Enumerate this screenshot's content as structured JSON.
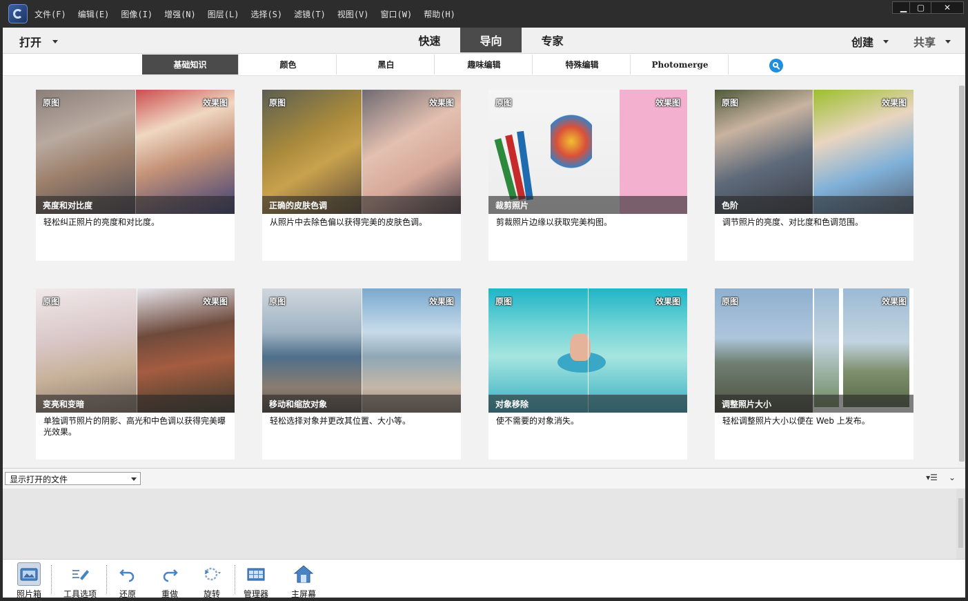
{
  "menu": [
    "文件(F)",
    "编辑(E)",
    "图像(I)",
    "增强(N)",
    "图层(L)",
    "选择(S)",
    "滤镜(T)",
    "视图(V)",
    "窗口(W)",
    "帮助(H)"
  ],
  "window_controls": {
    "minimize": "▁",
    "maximize": "▢",
    "close": "✕"
  },
  "modebar": {
    "open_label": "打开",
    "tabs": [
      {
        "label": "快速"
      },
      {
        "label": "导向",
        "active": true
      },
      {
        "label": "专家"
      }
    ],
    "create_label": "创建",
    "share_label": "共享"
  },
  "subtabs": [
    {
      "label": "基础知识",
      "active": true
    },
    {
      "label": "颜色"
    },
    {
      "label": "黑白"
    },
    {
      "label": "趣味编辑"
    },
    {
      "label": "特殊编辑"
    },
    {
      "label": "Photomerge"
    }
  ],
  "cards": [
    {
      "before": "原图",
      "after": "效果图",
      "title": "亮度和对比度",
      "desc": "轻松纠正照片的亮度和对比度。"
    },
    {
      "before": "原图",
      "after": "效果图",
      "title": "正确的皮肤色调",
      "desc": "从照片中去除色偏以获得完美的皮肤色调。"
    },
    {
      "before": "原图",
      "after": "效果图",
      "title": "裁剪照片",
      "desc": "剪裁照片边缘以获取完美构图。"
    },
    {
      "before": "原图",
      "after": "效果图",
      "title": "色阶",
      "desc": "调节照片的亮度、对比度和色调范围。"
    },
    {
      "before": "原图",
      "after": "效果图",
      "title": "变亮和变暗",
      "desc": "单独调节照片的阴影、高光和中色调以获得完美曝光效果。"
    },
    {
      "before": "原图",
      "after": "效果图",
      "title": "移动和缩放对象",
      "desc": "轻松选择对象并更改其位置、大小等。"
    },
    {
      "before": "原图",
      "after": "效果图",
      "title": "对象移除",
      "desc": "使不需要的对象消失。"
    },
    {
      "before": "原图",
      "after": "效果图",
      "title": "调整照片大小",
      "desc": "轻松调整照片大小以便在 Web 上发布。"
    }
  ],
  "photo_bin": {
    "dropdown_value": "显示打开的文件"
  },
  "toolbar": [
    {
      "label": "照片箱",
      "icon": "photo-bin-icon"
    },
    {
      "label": "工具选项",
      "icon": "tool-options-icon"
    },
    {
      "label": "还原",
      "icon": "undo-icon"
    },
    {
      "label": "重做",
      "icon": "redo-icon"
    },
    {
      "label": "旋转",
      "icon": "rotate-icon"
    },
    {
      "label": "管理器",
      "icon": "organizer-icon"
    },
    {
      "label": "主屏幕",
      "icon": "home-icon"
    }
  ]
}
